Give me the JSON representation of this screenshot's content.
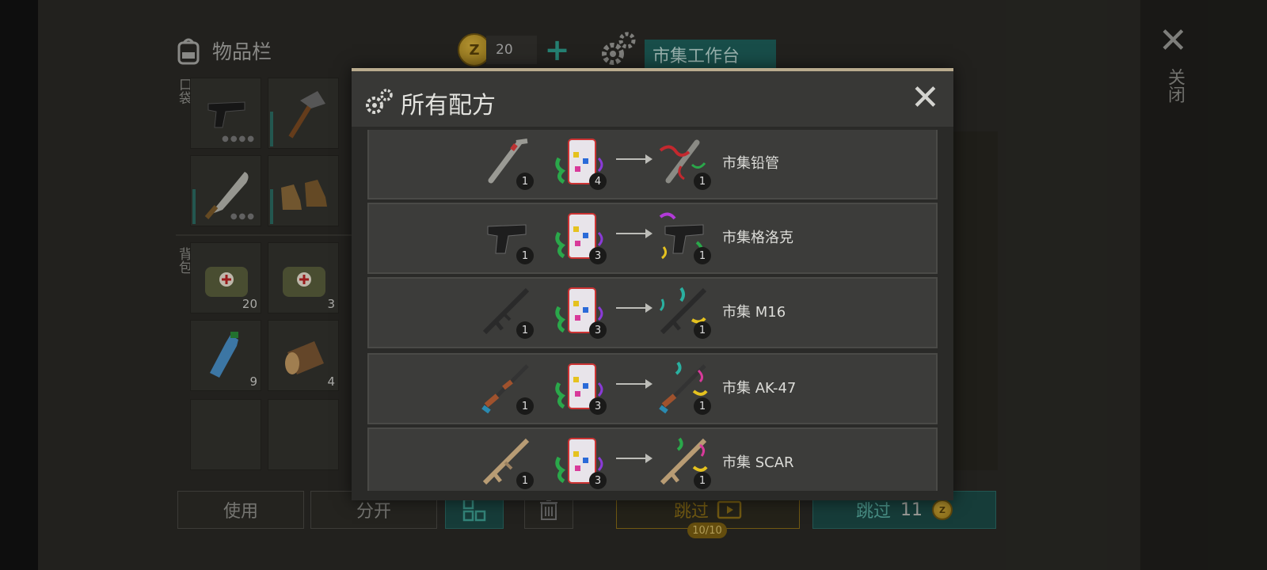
{
  "header": {
    "inventory_title": "物品栏",
    "coin_count": "20",
    "workbench_tab": "市集工作台",
    "close_label": "关闭"
  },
  "side_labels": {
    "pockets": "口袋",
    "backpack": "背包"
  },
  "slots": [
    {
      "item_icon": "pistol-icon",
      "qty": ""
    },
    {
      "item_icon": "hammer-icon",
      "qty": ""
    },
    {
      "item_icon": "machete-icon",
      "qty": ""
    },
    {
      "item_icon": "boots-icon",
      "qty": ""
    },
    {
      "item_icon": "medkit-bag-icon",
      "qty": "20"
    },
    {
      "item_icon": "medkit-bag-icon",
      "qty": "3"
    },
    {
      "item_icon": "water-bottle-icon",
      "qty": "9"
    },
    {
      "item_icon": "log-icon",
      "qty": "4"
    },
    {
      "item_icon": "",
      "qty": ""
    },
    {
      "item_icon": "",
      "qty": ""
    }
  ],
  "buttons": {
    "use": "使用",
    "split": "分开",
    "skip_ad": "跳过",
    "skip_ad_badge": "10/10",
    "skip_coin": "跳过",
    "skip_coin_cost": "11"
  },
  "modal": {
    "title": "所有配方",
    "recipes": [
      {
        "input_icon": "lead-pipe-icon",
        "input_qty": "1",
        "confetti_qty": "4",
        "output_qty": "1",
        "name": "市集铅管"
      },
      {
        "input_icon": "pistol-icon",
        "input_qty": "1",
        "confetti_qty": "3",
        "output_qty": "1",
        "name": "市集格洛克"
      },
      {
        "input_icon": "m16-icon",
        "input_qty": "1",
        "confetti_qty": "3",
        "output_qty": "1",
        "name": "市集 M16"
      },
      {
        "input_icon": "ak47-icon",
        "input_qty": "1",
        "confetti_qty": "3",
        "output_qty": "1",
        "name": "市集 AK-47"
      },
      {
        "input_icon": "scar-icon",
        "input_qty": "1",
        "confetti_qty": "3",
        "output_qty": "1",
        "name": "市集 SCAR"
      }
    ]
  },
  "colors": {
    "teal_accent": "#1e5f59",
    "gold": "#d9b23b",
    "modal_border": "#b9ab8e"
  }
}
